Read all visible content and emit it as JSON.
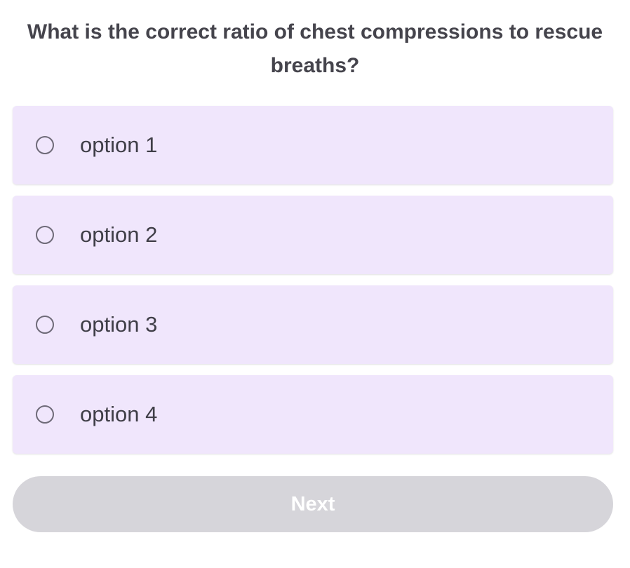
{
  "question": {
    "text": "What is the correct ratio of chest compressions to rescue breaths?"
  },
  "options": [
    {
      "label": "option 1",
      "selected": false
    },
    {
      "label": "option 2",
      "selected": false
    },
    {
      "label": "option 3",
      "selected": false
    },
    {
      "label": "option 4",
      "selected": false
    }
  ],
  "next_button": {
    "label": "Next",
    "enabled": false
  },
  "colors": {
    "option_background": "#f0e6fc",
    "next_disabled_background": "#d6d5da",
    "text": "#45444c"
  }
}
